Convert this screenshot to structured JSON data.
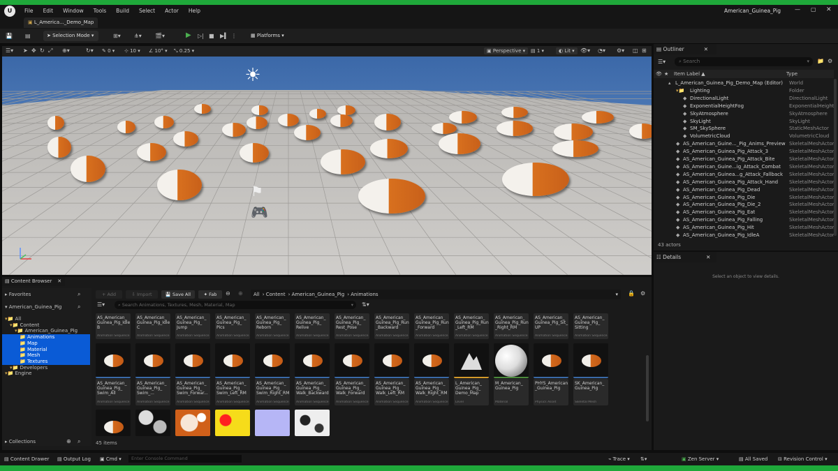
{
  "menu": [
    "File",
    "Edit",
    "Window",
    "Tools",
    "Build",
    "Select",
    "Actor",
    "Help"
  ],
  "window_title": "American_Guinea_Pig",
  "tab_label": "L_America..._Demo_Map",
  "toolbar": {
    "selection_mode": "Selection Mode",
    "platforms": "Platforms"
  },
  "viewport_bar": {
    "snap_rot": "0",
    "snap_grid": "10",
    "snap_angle": "10°",
    "snap_scale": "0.25",
    "view": "Perspective",
    "lit": "Lit",
    "screen_pct": "1"
  },
  "outliner": {
    "title": "Outliner",
    "search_placeholder": "Search",
    "col_label": "Item Label ▲",
    "col_type": "Type",
    "rows": [
      {
        "label": "L_American_Guinea_Pig_Demo_Map (Editor)",
        "type": "World",
        "indent": 0
      },
      {
        "label": "Lighting",
        "type": "Folder",
        "indent": 1
      },
      {
        "label": "DirectionalLight",
        "type": "DirectionalLight",
        "indent": 2
      },
      {
        "label": "ExponentialHeightFog",
        "type": "ExponentialHeightF",
        "indent": 2
      },
      {
        "label": "SkyAtmosphere",
        "type": "SkyAtmosphere",
        "indent": 2
      },
      {
        "label": "SkyLight",
        "type": "SkyLight",
        "indent": 2
      },
      {
        "label": "SM_SkySphere",
        "type": "StaticMeshActor",
        "indent": 2
      },
      {
        "label": "VolumetricCloud",
        "type": "VolumetricCloud",
        "indent": 2
      },
      {
        "label": "AS_American_Guine..._Pig_Anims_Preview",
        "type": "SkeletalMeshActor",
        "indent": 1
      },
      {
        "label": "AS_American_Guinea_Pig_Attack_3",
        "type": "SkeletalMeshActor",
        "indent": 1
      },
      {
        "label": "AS_American_Guinea_Pig_Attack_Bite",
        "type": "SkeletalMeshActor",
        "indent": 1
      },
      {
        "label": "AS_American_Guine...ig_Attack_Combat",
        "type": "SkeletalMeshActor",
        "indent": 1
      },
      {
        "label": "AS_American_Guinea...g_Attack_Fallback",
        "type": "SkeletalMeshActor",
        "indent": 1
      },
      {
        "label": "AS_American_Guinea_Pig_Attack_Hand",
        "type": "SkeletalMeshActor",
        "indent": 1
      },
      {
        "label": "AS_American_Guinea_Pig_Dead",
        "type": "SkeletalMeshActor",
        "indent": 1
      },
      {
        "label": "AS_American_Guinea_Pig_Die",
        "type": "SkeletalMeshActor",
        "indent": 1
      },
      {
        "label": "AS_American_Guinea_Pig_Die_2",
        "type": "SkeletalMeshActor",
        "indent": 1
      },
      {
        "label": "AS_American_Guinea_Pig_Eat",
        "type": "SkeletalMeshActor",
        "indent": 1
      },
      {
        "label": "AS_American_Guinea_Pig_Falling",
        "type": "SkeletalMeshActor",
        "indent": 1
      },
      {
        "label": "AS_American_Guinea_Pig_Hit",
        "type": "SkeletalMeshActor",
        "indent": 1
      },
      {
        "label": "AS_American_Guinea_Pig_IdleA",
        "type": "SkeletalMeshActor",
        "indent": 1
      }
    ],
    "count": "43 actors"
  },
  "details": {
    "title": "Details",
    "empty": "Select an object to view details."
  },
  "content_browser": {
    "title": "Content Browser",
    "add": "+ Add",
    "import": "Import",
    "save_all": "Save All",
    "fab": "Fab",
    "breadcrumb": [
      "All",
      "Content",
      "American_Guinea_Pig",
      "Animations"
    ],
    "search_placeholder": "Search Animations, Textures, Mesh, Material, Map",
    "favorites": "Favorites",
    "root": "American_Guinea_Pig",
    "collections": "Collections",
    "items_count": "45 items",
    "tree": [
      {
        "label": "All",
        "indent": 0,
        "sel": false
      },
      {
        "label": "Content",
        "indent": 1,
        "sel": false
      },
      {
        "label": "American_Guinea_Pig",
        "indent": 2,
        "sel": false
      },
      {
        "label": "Animations",
        "indent": 3,
        "sel": true
      },
      {
        "label": "Map",
        "indent": 3,
        "sel": true
      },
      {
        "label": "Material",
        "indent": 3,
        "sel": true
      },
      {
        "label": "Mesh",
        "indent": 3,
        "sel": true
      },
      {
        "label": "Textures",
        "indent": 3,
        "sel": true
      },
      {
        "label": "Developers",
        "indent": 1,
        "sel": false
      },
      {
        "label": "Engine",
        "indent": 0,
        "sel": false
      }
    ],
    "row1": [
      {
        "name": "AS_American_ Guinea_Pig_Idle B",
        "kind": "Animation Sequence"
      },
      {
        "name": "AS_American_ Guinea_Pig_Idle C",
        "kind": "Animation Sequence"
      },
      {
        "name": "AS_American_ Guinea_Pig_ Jump",
        "kind": "Animation Sequence"
      },
      {
        "name": "AS_American_ Guinea_Pig_ Pics",
        "kind": "Animation Sequence"
      },
      {
        "name": "AS_American_ Guinea_Pig_ Reborn",
        "kind": "Animation Sequence"
      },
      {
        "name": "AS_American_ Guinea_Pig_ Relive",
        "kind": "Animation Sequence"
      },
      {
        "name": "AS_American_ Guinea_Pig_ Rest_Pose",
        "kind": "Animation Sequence"
      },
      {
        "name": "AS_American_ Guinea_Pig_Run _Backward",
        "kind": "Animation Sequence"
      },
      {
        "name": "AS_American_ Guinea_Pig_Run _Forward",
        "kind": "Animation Sequence"
      },
      {
        "name": "AS_American_ Guinea_Pig_Run _Left_RM",
        "kind": "Animation Sequence"
      },
      {
        "name": "AS_American_ Guinea_Pig_Run _Right_RM",
        "kind": "Animation Sequence"
      },
      {
        "name": "AS_American_ Guinea_Pig_Sit_ UP",
        "kind": "Animation Sequence"
      },
      {
        "name": "AS_American_ Guinea_Pig_ Sitting",
        "kind": "Animation Sequence"
      }
    ],
    "row2": [
      {
        "name": "AS_American_ Guinea_Pig_ Swim_All",
        "kind": "Animation Sequence",
        "thumb": "pig"
      },
      {
        "name": "AS_American_ Guinea_Pig_ Swim_...",
        "kind": "Animation Sequence",
        "thumb": "pig"
      },
      {
        "name": "AS_American_ Guinea_Pig_ Swim_Forwar...",
        "kind": "Animation Sequence",
        "thumb": "pig"
      },
      {
        "name": "AS_American_ Guinea_Pig_ Swim_Left_RM",
        "kind": "Animation Sequence",
        "thumb": "pig"
      },
      {
        "name": "AS_American_ Guinea_Pig_ Swim_Right_RM",
        "kind": "Animation Sequence",
        "thumb": "pig"
      },
      {
        "name": "AS_American_ Guinea_Pig_ Walk_Backward",
        "kind": "Animation Sequence",
        "thumb": "pig"
      },
      {
        "name": "AS_American_ Guinea_Pig_ Walk_Forward",
        "kind": "Animation Sequence",
        "thumb": "pig"
      },
      {
        "name": "AS_American_ Guinea_Pig_ Walk_Left_RM",
        "kind": "Animation Sequence",
        "thumb": "pig"
      },
      {
        "name": "AS_American_ Guinea_Pig_ Walk_Right_RM",
        "kind": "Animation Sequence",
        "thumb": "pig"
      },
      {
        "name": "L_American_ Guinea_Pig_ Demo_Map",
        "kind": "Level",
        "thumb": "level"
      },
      {
        "name": "M_American_ Guinea_Pig",
        "kind": "Material",
        "thumb": "sphere"
      },
      {
        "name": "PHYS_American _Guinea_Pig",
        "kind": "Physics Asset",
        "thumb": "pig"
      },
      {
        "name": "SK_American_ Guinea_Pig",
        "kind": "Skeletal Mesh",
        "thumb": "pig"
      }
    ],
    "row3": [
      "pig",
      "tex-bw",
      "tex-orange",
      "tex-yellow",
      "tex-lilac",
      "tex-white"
    ]
  },
  "status": {
    "drawer": "Content Drawer",
    "output": "Output Log",
    "cmd": "Cmd",
    "console_placeholder": "Enter Console Command",
    "trace": "Trace",
    "zen": "Zen Server",
    "saved": "All Saved",
    "revision": "Revision Control"
  },
  "colors": {
    "accent_green": "#1fa83a",
    "selection_blue": "#0a5bd6",
    "play_green": "#4caf50",
    "folder": "#c9a14a"
  }
}
